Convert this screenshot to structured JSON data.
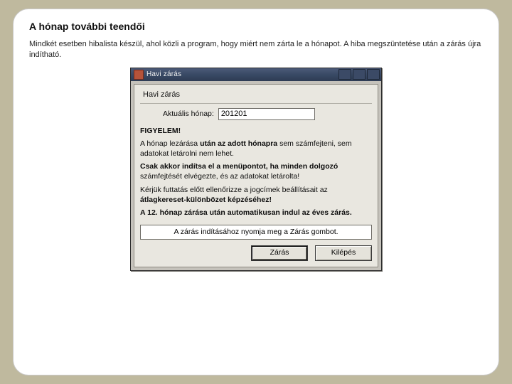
{
  "card": {
    "title": "A hónap további teendői",
    "body": "Mindkét esetben hibalista készül, ahol közli a program, hogy miért nem zárta le a hónapot. A hiba megszüntetése után a zárás újra indítható."
  },
  "dialog": {
    "titlebar": "Havi zárás",
    "header": "Havi zárás",
    "current_month_label": "Aktuális hónap:",
    "current_month_value": "201201",
    "warn_heading": "FIGYELEM!",
    "warn_line1a": "A hónap lezárása ",
    "warn_line1b": "után az adott hónapra",
    "warn_line1c": " sem számfejteni, sem adatokat letárolni nem lehet.",
    "warn_line2a": "Csak akkor indítsa el a menüpontot, ha minden dolgozó",
    "warn_line2b": " számfejtését elvégezte, és az adatokat letárolta!",
    "warn_line3a": "Kérjük futtatás előtt ellenőrizze a jogcímek beállításait az ",
    "warn_line3b": "átlagkereset-különbözet képzéséhez!",
    "warn_line4": "A 12. hónap zárása után automatikusan indul az éves zárás.",
    "prompt": "A zárás indításához nyomja meg a Zárás gombot.",
    "btn_primary": "Zárás",
    "btn_secondary": "Kilépés"
  }
}
